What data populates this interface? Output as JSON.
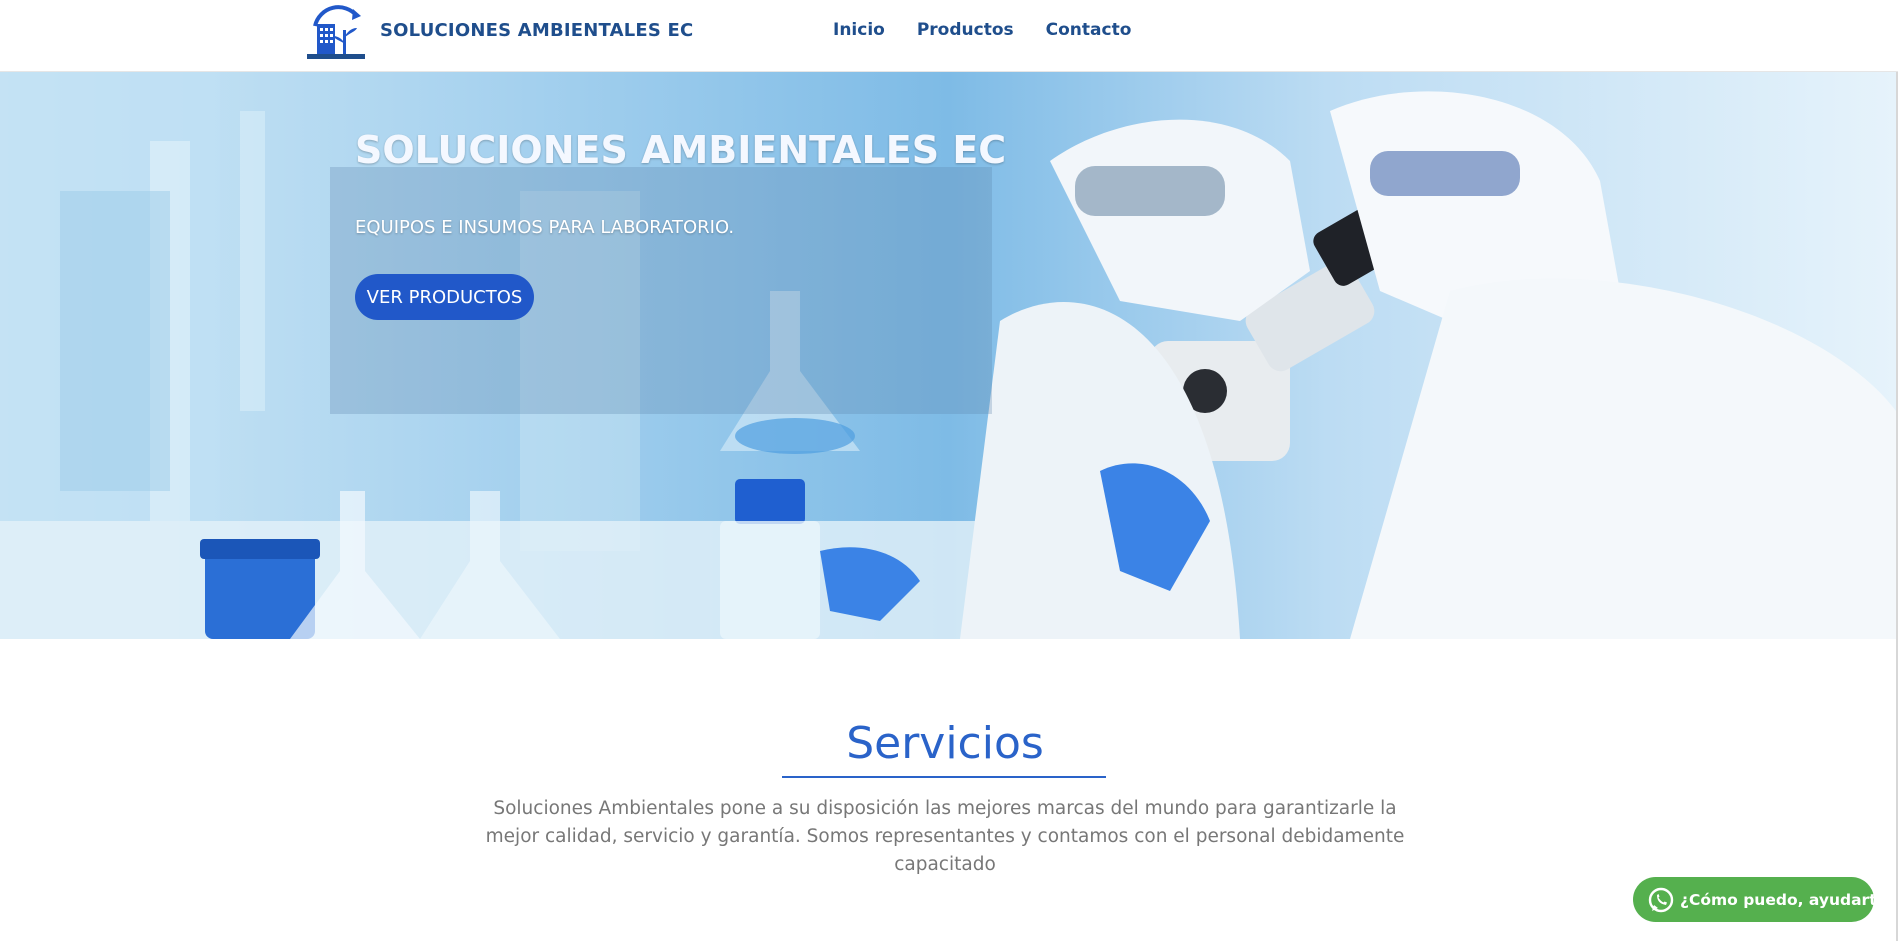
{
  "header": {
    "brand": "SOLUCIONES AMBIENTALES EC",
    "nav": [
      {
        "label": "Inicio"
      },
      {
        "label": "Productos"
      },
      {
        "label": "Contacto"
      }
    ]
  },
  "hero": {
    "title": "SOLUCIONES AMBIENTALES EC",
    "subtitle": "EQUIPOS E INSUMOS PARA LABORATORIO.",
    "button_label": "VER PRODUCTOS"
  },
  "services": {
    "title": "Servicios",
    "text": "Soluciones Ambientales pone a su disposición las mejores marcas del mundo para garantizarle la mejor calidad, servicio y garantía. Somos representantes y contamos con el personal debidamente capacitado"
  },
  "whatsapp": {
    "label": "¿Cómo puedo, ayudarte?"
  },
  "colors": {
    "brand": "#1f4e8c",
    "accent": "#2158c9",
    "whatsapp": "#55b04e"
  }
}
